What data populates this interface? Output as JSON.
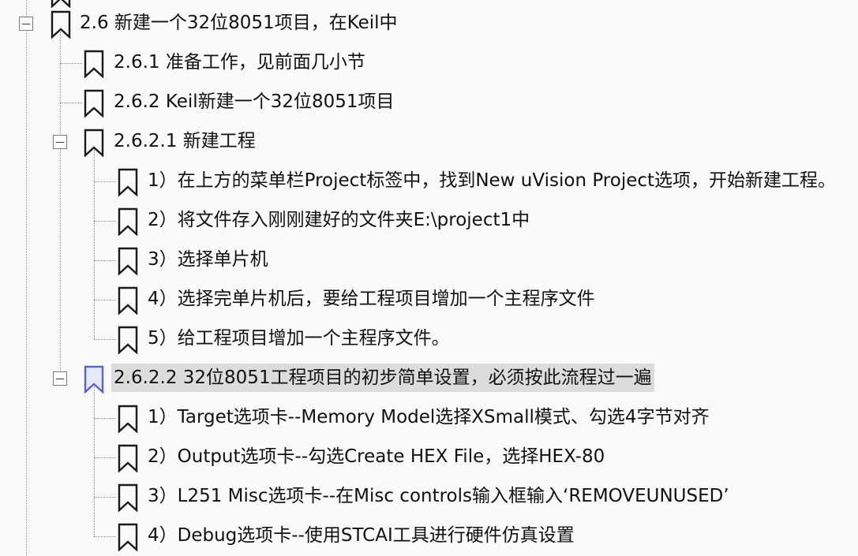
{
  "bookmarks": [
    {
      "id": "n26",
      "label": "2.6 新建一个32位8051项目，在Keil中",
      "expanded": true,
      "selected": false
    },
    {
      "id": "n261",
      "label": "2.6.1 准备工作，见前面几小节",
      "selected": false
    },
    {
      "id": "n262",
      "label": "2.6.2  Keil新建一个32位8051项目",
      "selected": false
    },
    {
      "id": "n2621",
      "label": "2.6.2.1 新建工程",
      "expanded": true,
      "selected": false
    },
    {
      "id": "n2621a",
      "label": "1）在上方的菜单栏Project标签中，找到New uVision Project选项，开始新建工程。",
      "selected": false
    },
    {
      "id": "n2621b",
      "label": "2）将文件存入刚刚建好的文件夹E:\\project1中",
      "selected": false
    },
    {
      "id": "n2621c",
      "label": "3）选择单片机",
      "selected": false
    },
    {
      "id": "n2621d",
      "label": "4）选择完单片机后，要给工程项目增加一个主程序文件",
      "selected": false
    },
    {
      "id": "n2621e",
      "label": "5）给工程项目增加一个主程序文件。",
      "selected": false
    },
    {
      "id": "n2622",
      "label": "2.6.2.2  32位8051工程项目的初步简单设置，必须按此流程过一遍",
      "expanded": true,
      "selected": true
    },
    {
      "id": "n2622a",
      "label": "1）Target选项卡--Memory Model选择XSmall模式、勾选4字节对齐",
      "selected": false
    },
    {
      "id": "n2622b",
      "label": "2）Output选项卡--勾选Create HEX File，选择HEX-80",
      "selected": false
    },
    {
      "id": "n2622c",
      "label": "3）L251 Misc选项卡--在Misc controls输入框输入‘REMOVEUNUSED’",
      "selected": false
    },
    {
      "id": "n2622d",
      "label": "4）Debug选项卡--使用STCAI工具进行硬件仿真设置",
      "selected": false
    }
  ],
  "colors": {
    "background": "#fafafa",
    "selected_bg": "#dcdcdc",
    "bookmark_stroke": "#1a1a1a",
    "bookmark_selected_stroke": "#5a63c8",
    "bookmark_selected_fill": "#e6e8fb"
  }
}
